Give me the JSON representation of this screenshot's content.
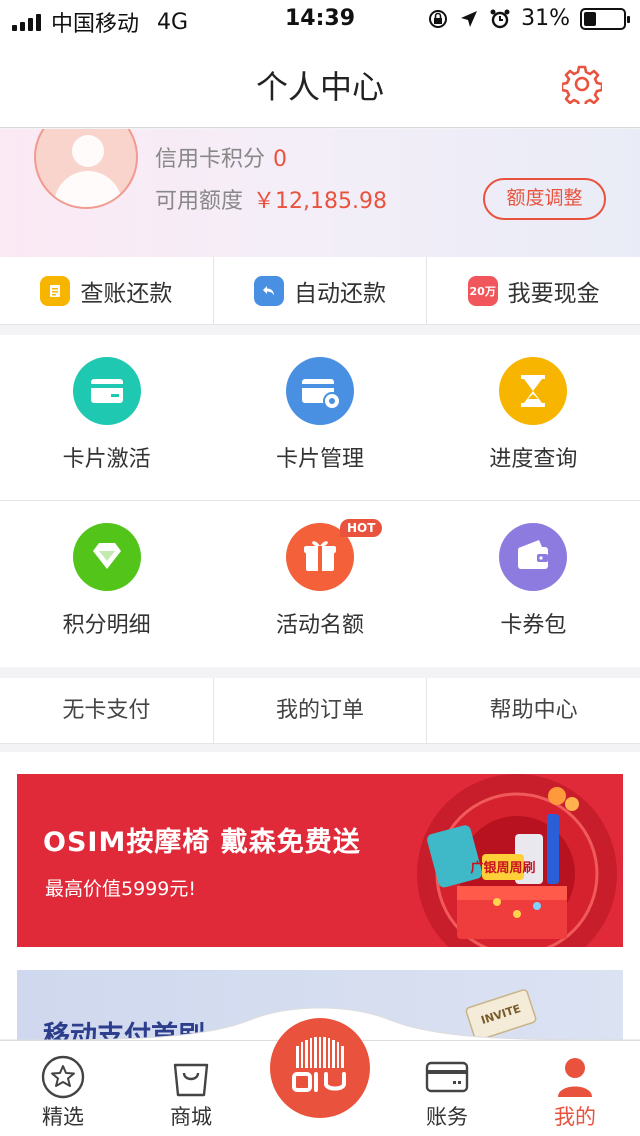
{
  "status_bar": {
    "carrier": "中国移动",
    "network": "4G",
    "time": "14:39",
    "battery": "31%",
    "battery_level": 0.31
  },
  "nav": {
    "title": "个人中心",
    "settings_icon": "gear-icon"
  },
  "profile": {
    "points_label": "信用卡积分",
    "points_value": "0",
    "limit_label": "可用额度",
    "limit_value": "￥12,185.98",
    "adjust_button": "额度调整"
  },
  "quick_actions": [
    {
      "label": "查账还款",
      "icon": "bill-icon",
      "color": "#f7b500"
    },
    {
      "label": "自动还款",
      "icon": "return-arrow-icon",
      "color": "#4a90e2"
    },
    {
      "label": "我要现金",
      "icon": "cash-20wan-icon",
      "icon_text": "20万",
      "color": "#f0565c"
    }
  ],
  "grid": [
    {
      "label": "卡片激活",
      "icon": "card-icon",
      "color": "#1fc8b0"
    },
    {
      "label": "卡片管理",
      "icon": "card-settings-icon",
      "color": "#4a90e2"
    },
    {
      "label": "进度查询",
      "icon": "hourglass-icon",
      "color": "#f7b500"
    },
    {
      "label": "积分明细",
      "icon": "diamond-icon",
      "color": "#52c41a"
    },
    {
      "label": "活动名额",
      "icon": "gift-icon",
      "color": "#f4603a",
      "badge": "HOT"
    },
    {
      "label": "卡券包",
      "icon": "wallet-icon",
      "color": "#8e7be0"
    }
  ],
  "links": [
    {
      "label": "无卡支付"
    },
    {
      "label": "我的订单"
    },
    {
      "label": "帮助中心"
    }
  ],
  "banners": [
    {
      "headline": "OSIM按摩椅 戴森免费送",
      "subline": "最高价值5999元!",
      "color": "#e02a3a",
      "badge": "广银周周刷"
    },
    {
      "headline": "移动支付首刷",
      "color": "#cfd8ee",
      "badge": "INVITE"
    }
  ],
  "tab_bar": {
    "tabs": [
      {
        "label": "精选",
        "icon": "star-icon",
        "active": false
      },
      {
        "label": "商城",
        "icon": "shopping-bag-icon",
        "active": false
      },
      {
        "label": "账务",
        "icon": "card-icon",
        "active": false
      },
      {
        "label": "我的",
        "icon": "user-icon",
        "active": true
      }
    ],
    "center_icon": "barcode-logo-icon",
    "accent": "#e9533d"
  }
}
